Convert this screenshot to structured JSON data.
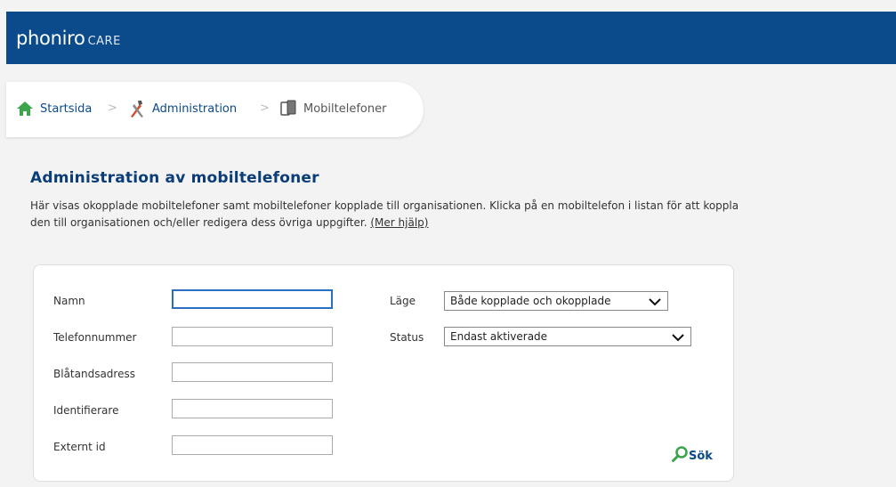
{
  "header": {
    "brand": "phoniro",
    "brand_sub": "CARE",
    "bar_color": "#0b4a8b"
  },
  "breadcrumb": {
    "items": [
      {
        "label": "Startsida",
        "icon": "home-icon"
      },
      {
        "label": "Administration",
        "icon": "tools-icon"
      },
      {
        "label": "Mobiltelefoner",
        "icon": "phones-icon"
      }
    ],
    "separator": ">"
  },
  "page": {
    "title": "Administration av mobiltelefoner",
    "intro": "Här visas okopplade mobiltelefoner samt mobiltelefoner kopplade till organisationen. Klicka på en mobiltelefon i listan för att koppla den till organisationen och/eller redigera dess övriga uppgifter.",
    "help_link": "(Mer hjälp)"
  },
  "form": {
    "fields": [
      {
        "label": "Namn",
        "value": ""
      },
      {
        "label": "Telefonnummer",
        "value": ""
      },
      {
        "label": "Blåtandsadress",
        "value": ""
      },
      {
        "label": "Identifierare",
        "value": ""
      },
      {
        "label": "Externt id",
        "value": ""
      }
    ],
    "mode_label": "Läge",
    "mode_value": "Både kopplade och okopplade",
    "status_label": "Status",
    "status_value": "Endast aktiverade",
    "search_label": "Sök"
  }
}
